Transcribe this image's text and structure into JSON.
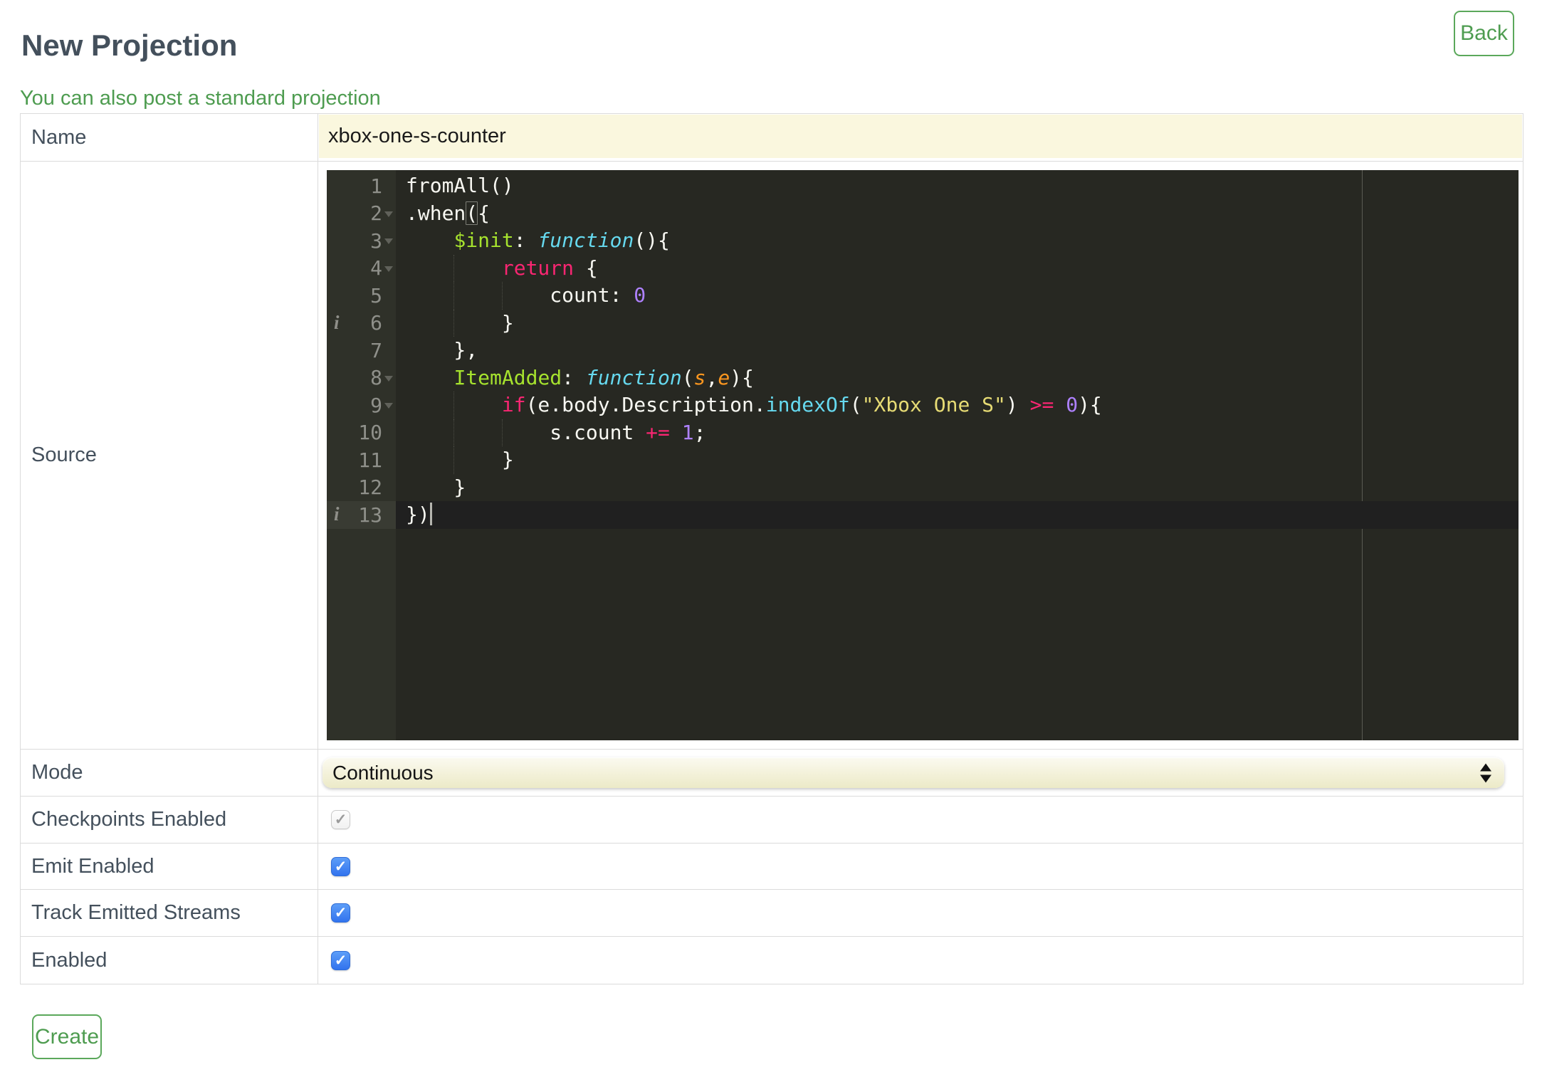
{
  "colors": {
    "accent_green": "#4E9C50",
    "green_border": "#5BA85B",
    "heading_slate": "#44505C",
    "input_yellow": "#FAF7DE",
    "editor_background": "#272822",
    "editor_gutter": "#2F3129",
    "checkbox_blue": "#3273EE"
  },
  "header": {
    "title": "New Projection",
    "back_label": "Back"
  },
  "link": {
    "text": "You can also post a standard projection"
  },
  "form": {
    "name": {
      "label": "Name",
      "value": "xbox-one-s-counter"
    },
    "source": {
      "label": "Source"
    },
    "mode": {
      "label": "Mode",
      "value": "Continuous"
    },
    "checkpoints": {
      "label": "Checkpoints Enabled",
      "checked": true,
      "disabled": true
    },
    "emit": {
      "label": "Emit Enabled",
      "checked": true,
      "disabled": false
    },
    "track": {
      "label": "Track Emitted Streams",
      "checked": true,
      "disabled": false
    },
    "enabled": {
      "label": "Enabled",
      "checked": true,
      "disabled": false
    },
    "create_label": "Create"
  },
  "icons": {
    "check": "✓",
    "info": "i"
  },
  "editor": {
    "lines": [
      {
        "num": 1,
        "segments": [
          {
            "t": "fromAll()"
          }
        ]
      },
      {
        "num": 2,
        "fold": true,
        "segments": [
          {
            "t": ".when"
          },
          {
            "t": "(",
            "m": true
          },
          {
            "t": "{"
          }
        ]
      },
      {
        "num": 3,
        "fold": true,
        "segments": [
          {
            "t": "    "
          },
          {
            "t": "$init",
            "s": "entity"
          },
          {
            "t": ": "
          },
          {
            "t": "function",
            "s": "storage"
          },
          {
            "t": "(){"
          }
        ]
      },
      {
        "num": 4,
        "fold": true,
        "segments": [
          {
            "t": "        "
          },
          {
            "t": "return",
            "s": "keyword"
          },
          {
            "t": " {"
          }
        ]
      },
      {
        "num": 5,
        "segments": [
          {
            "t": "            count: "
          },
          {
            "t": "0",
            "s": "constant"
          }
        ]
      },
      {
        "num": 6,
        "info": true,
        "segments": [
          {
            "t": "        }"
          }
        ]
      },
      {
        "num": 7,
        "segments": [
          {
            "t": "    },"
          }
        ]
      },
      {
        "num": 8,
        "fold": true,
        "segments": [
          {
            "t": "    "
          },
          {
            "t": "ItemAdded",
            "s": "entity"
          },
          {
            "t": ": "
          },
          {
            "t": "function",
            "s": "storage"
          },
          {
            "t": "("
          },
          {
            "t": "s",
            "s": "param"
          },
          {
            "t": ","
          },
          {
            "t": "e",
            "s": "param"
          },
          {
            "t": "){"
          }
        ]
      },
      {
        "num": 9,
        "fold": true,
        "segments": [
          {
            "t": "        "
          },
          {
            "t": "if",
            "s": "keyword"
          },
          {
            "t": "(e.body.Description."
          },
          {
            "t": "indexOf",
            "s": "support"
          },
          {
            "t": "("
          },
          {
            "t": "\"Xbox One S\"",
            "s": "string"
          },
          {
            "t": ") "
          },
          {
            "t": ">=",
            "s": "keyword"
          },
          {
            "t": " "
          },
          {
            "t": "0",
            "s": "constant"
          },
          {
            "t": "){"
          }
        ]
      },
      {
        "num": 10,
        "segments": [
          {
            "t": "            s.count "
          },
          {
            "t": "+=",
            "s": "keyword"
          },
          {
            "t": " "
          },
          {
            "t": "1",
            "s": "constant"
          },
          {
            "t": ";"
          }
        ]
      },
      {
        "num": 11,
        "segments": [
          {
            "t": "        }"
          }
        ]
      },
      {
        "num": 12,
        "segments": [
          {
            "t": "    }"
          }
        ]
      },
      {
        "num": 13,
        "info": true,
        "active": true,
        "cursor": true,
        "segments": [
          {
            "t": "})"
          }
        ]
      }
    ]
  }
}
